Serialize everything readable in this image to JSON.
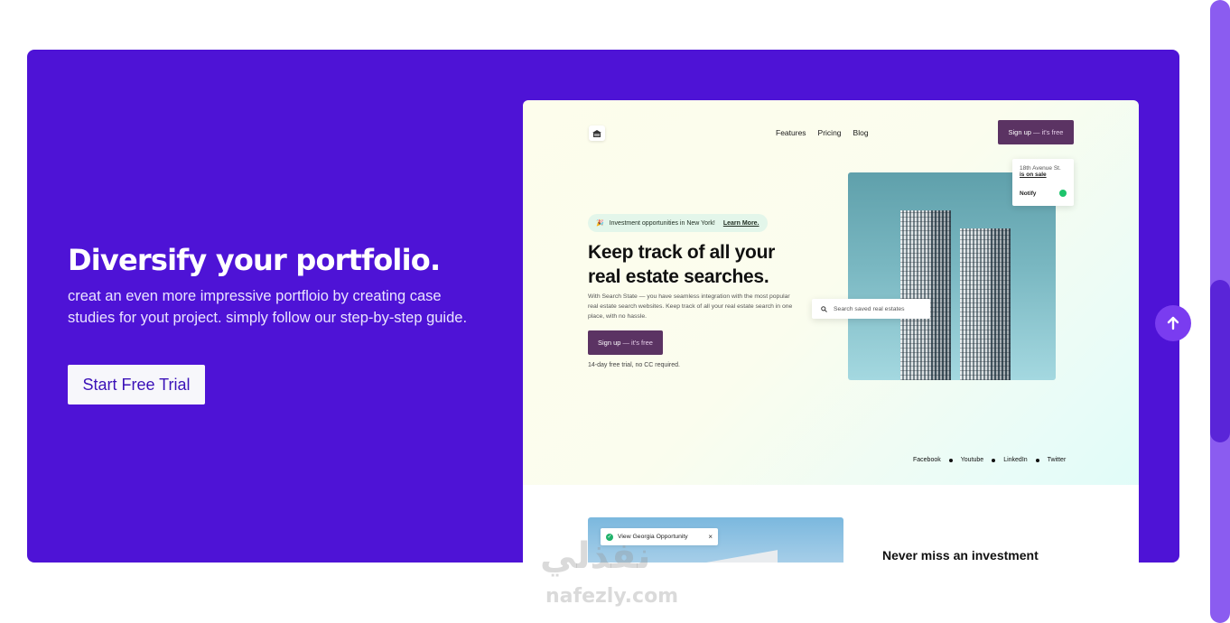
{
  "hero": {
    "title": "Diversify your portfolio.",
    "description": "creat an even more impressive portfloio by creating case studies for yout project. simply follow our step-by-step guide.",
    "cta_label": "Start Free Trial"
  },
  "mockup": {
    "logo_icon": "building-icon",
    "nav": [
      "Features",
      "Pricing",
      "Blog"
    ],
    "signup_label": "Sign up",
    "signup_suffix": "— it's free",
    "badge_text": "Investment opportunities in New York!",
    "badge_link": "Learn More.",
    "headline": "Keep track of all your real estate searches.",
    "paragraph": "With Search State — you have seamless integration with the most popular real estate search websites. Keep track of all your real estate search in one place, with no hassle.",
    "button_label": "Sign up",
    "button_suffix": "— it's free",
    "note": "14-day free trial, no CC required.",
    "notify_card": {
      "street": "18th Avenue St.",
      "status": "is on sale",
      "label": "Notify"
    },
    "search_placeholder": "Search saved real estates",
    "socials": [
      "Facebook",
      "Youtube",
      "LinkedIn",
      "Twitter"
    ],
    "lower_pill": "View Georgia Opportunity",
    "lower_pill_close": "×",
    "lower_heading": "Never miss an investment"
  },
  "watermark": {
    "arabic": "نفذلي",
    "latin": "nafezly.com"
  },
  "colors": {
    "hero_bg": "#4e13d6",
    "accent_purple": "#5b3363",
    "scroll_button": "#7a3cf0",
    "notify_green": "#1ec46c"
  }
}
